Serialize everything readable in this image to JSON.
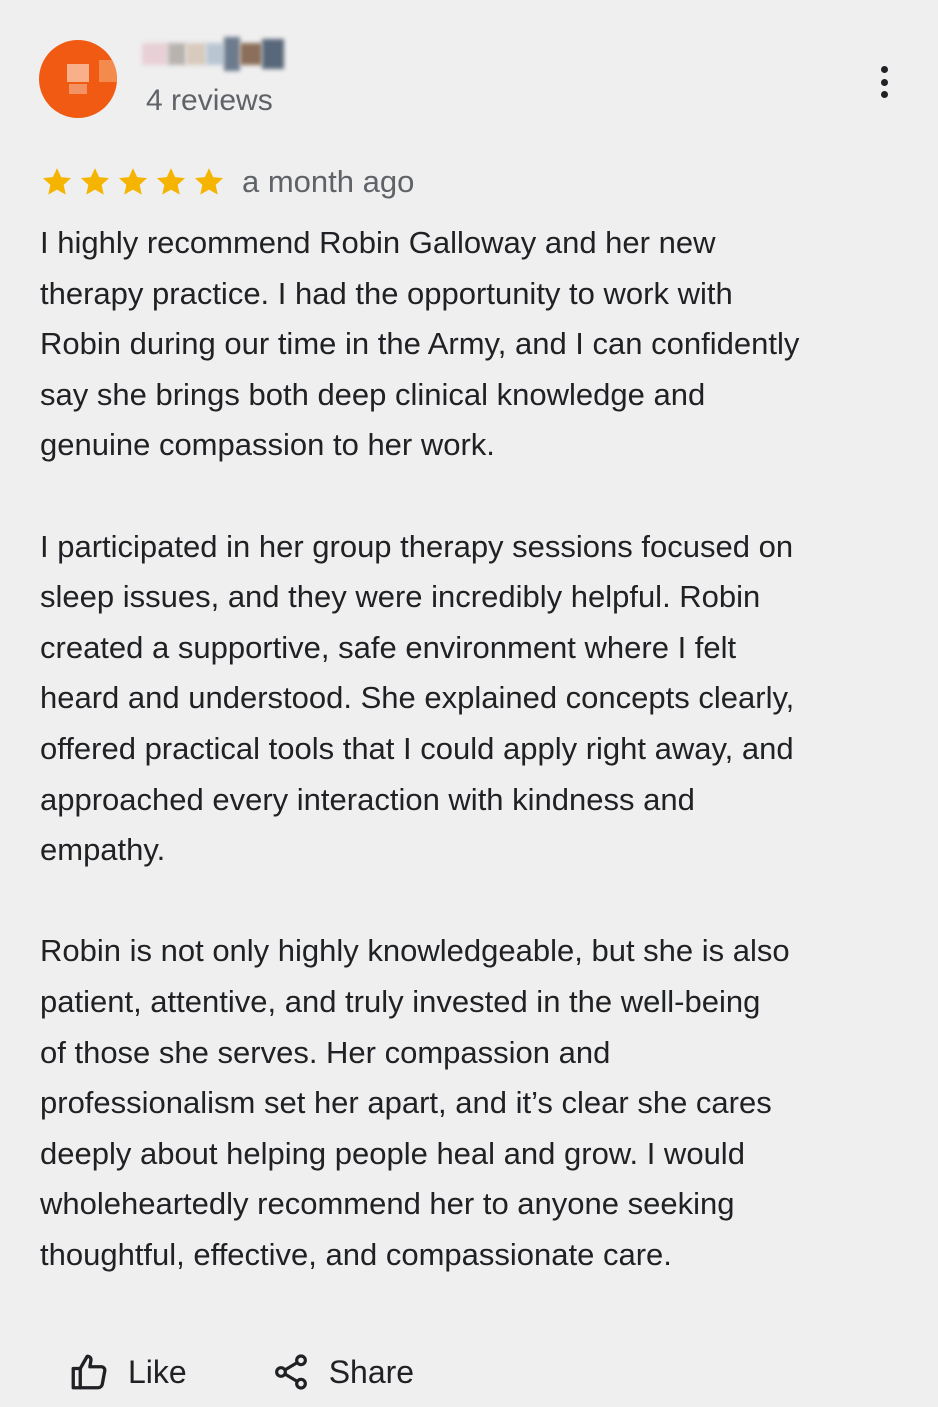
{
  "reviewer": {
    "name_hidden": true,
    "review_count": "4 reviews",
    "avatar_color": "#f05a12"
  },
  "rating": {
    "stars": 5,
    "max_stars": 5,
    "star_color": "#f4b400",
    "date": "a month ago"
  },
  "review": {
    "paragraphs": [
      "I highly recommend Robin Galloway and her new\ntherapy practice. I had the opportunity to work with\nRobin during our time in the Army, and I can confidently\nsay she brings both deep clinical knowledge and\ngenuine compassion to her work.",
      "I participated in her group therapy sessions focused on\nsleep issues, and they were incredibly helpful. Robin\ncreated a supportive, safe environment where I felt\nheard and understood. She explained concepts clearly,\noffered practical tools that I could apply right away, and\napproached every interaction with kindness and\nempathy.",
      "Robin is not only highly knowledgeable, but she is also\npatient, attentive, and truly invested in the well-being\nof those she serves. Her compassion and\nprofessionalism set her apart, and it’s clear she cares\ndeeply about helping people heal and grow. I would\nwholeheartedly recommend her to anyone seeking\nthoughtful, effective, and compassionate care."
    ]
  },
  "actions": {
    "like_label": "Like",
    "share_label": "Share"
  },
  "icons": {
    "more": "more-vert-icon",
    "like": "thumbs-up-icon",
    "share": "share-icon",
    "star": "star-icon"
  }
}
